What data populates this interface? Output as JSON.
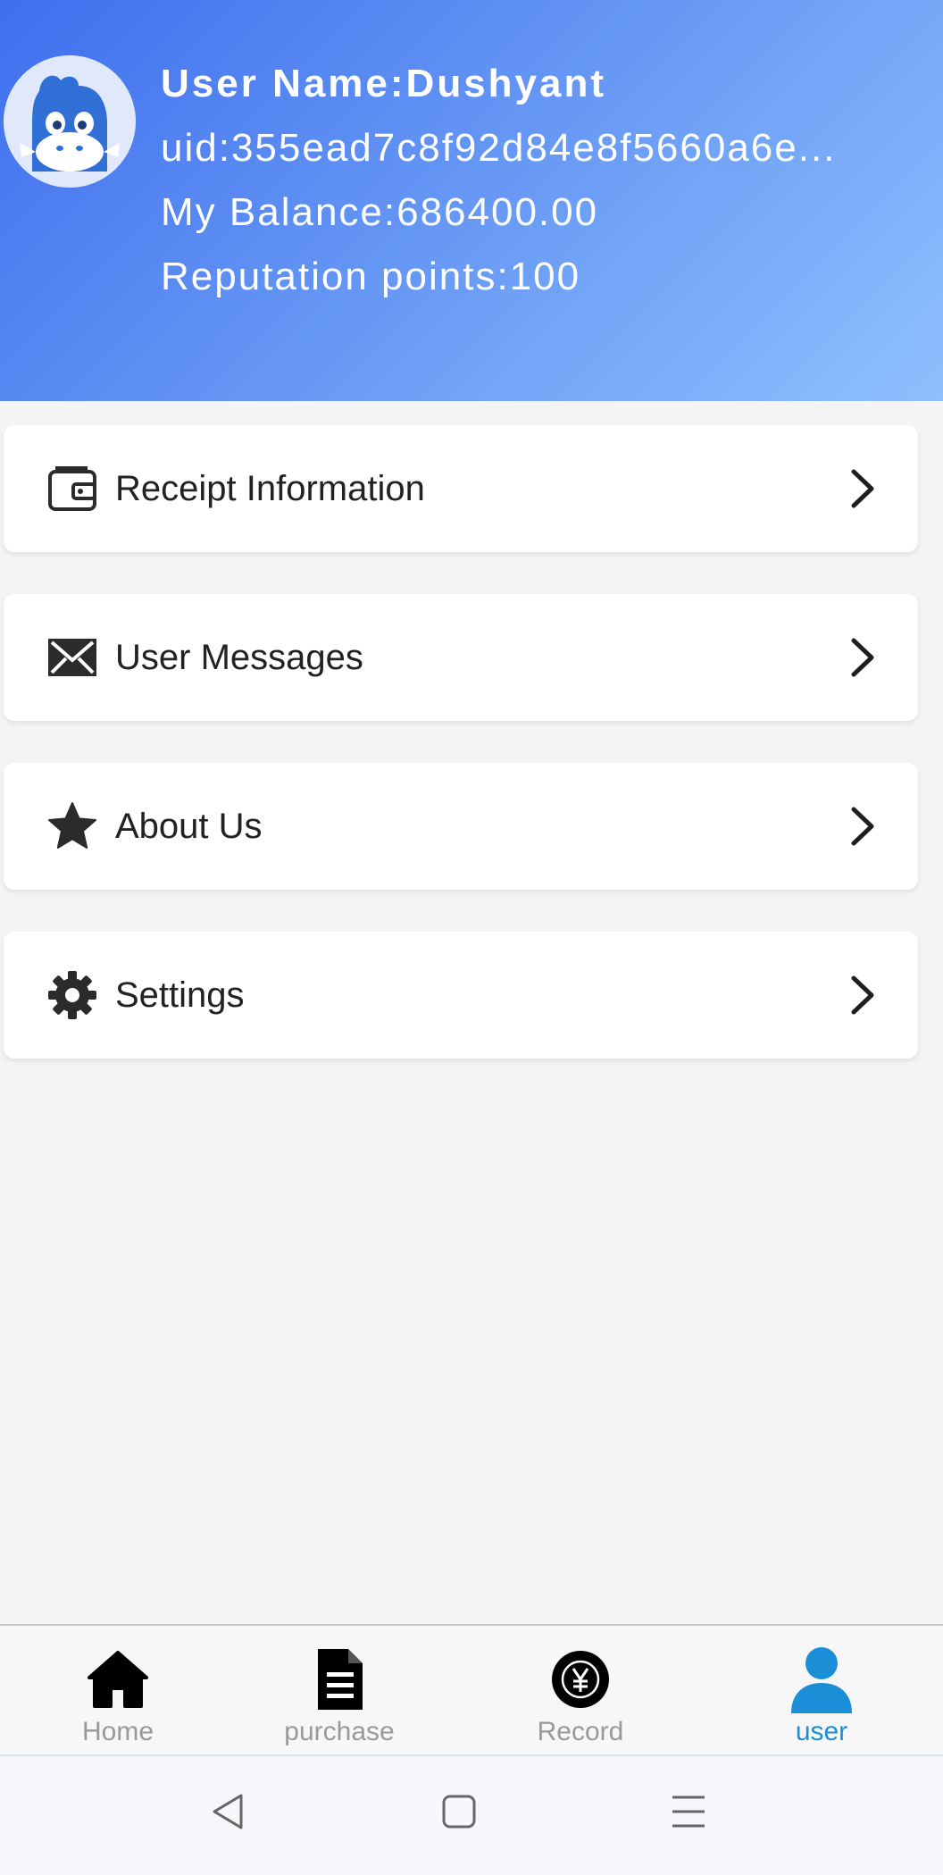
{
  "profile": {
    "username_line": "User Name:Dushyant",
    "uid_line": "uid:355ead7c8f92d84e8f5660a6e...",
    "balance_line": "My Balance:686400.00",
    "reputation_line": "Reputation points:100",
    "avatar_icon": "mascot-avatar"
  },
  "menu": {
    "items": [
      {
        "label": "Receipt Information",
        "icon": "wallet-icon"
      },
      {
        "label": "User Messages",
        "icon": "envelope-icon"
      },
      {
        "label": "About Us",
        "icon": "star-icon"
      },
      {
        "label": "Settings",
        "icon": "gear-icon"
      }
    ]
  },
  "tabbar": {
    "tabs": [
      {
        "label": "Home",
        "icon": "home-icon",
        "active": false
      },
      {
        "label": "purchase",
        "icon": "document-icon",
        "active": false
      },
      {
        "label": "Record",
        "icon": "yuan-coin-icon",
        "active": false
      },
      {
        "label": "user",
        "icon": "user-icon",
        "active": true
      }
    ],
    "active_color": "#1a8fd8",
    "inactive_color": "#999999"
  },
  "colors": {
    "header_gradient_start": "#3f6fee",
    "header_gradient_end": "#8ec0ff",
    "page_background": "#f4f4f4"
  }
}
